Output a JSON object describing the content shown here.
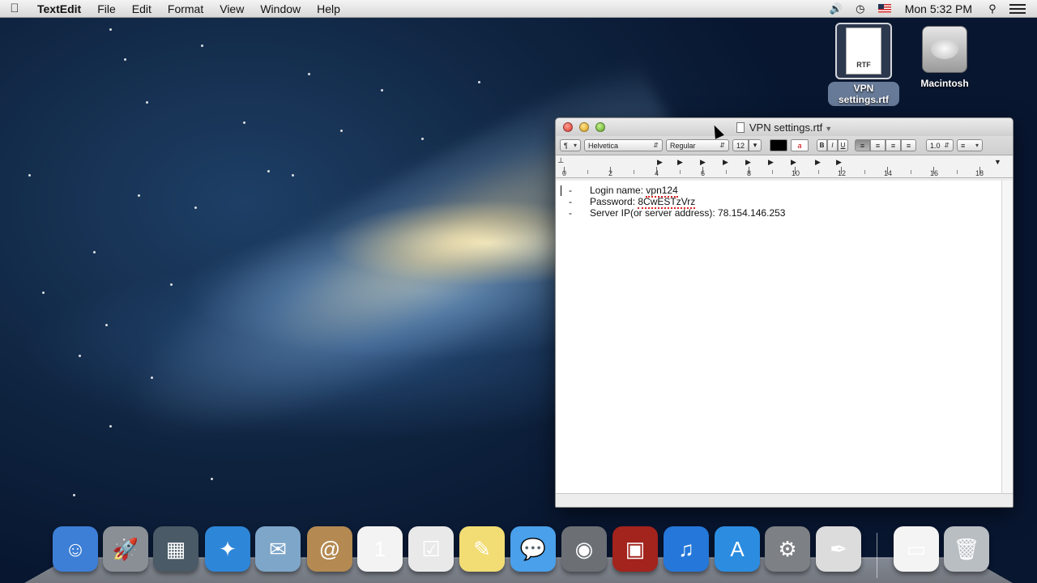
{
  "menubar": {
    "app_name": "TextEdit",
    "menus": [
      "File",
      "Edit",
      "Format",
      "View",
      "Window",
      "Help"
    ],
    "clock": "Mon 5:32 PM"
  },
  "desktop": {
    "rtf_file": {
      "label_line1": "VPN",
      "label_line2": "settings.rtf",
      "doc_badge": "RTF"
    },
    "hard_drive": {
      "label": "Macintosh"
    }
  },
  "window": {
    "title": "VPN  settings.rtf",
    "toolbar": {
      "paragraph": "¶",
      "font_family": "Helvetica",
      "typeface": "Regular",
      "font_size": "12",
      "bold": "B",
      "italic": "I",
      "underline": "U",
      "line_spacing": "1.0",
      "highlight_glyph": "a"
    },
    "ruler_numbers": [
      "0",
      "2",
      "4",
      "6",
      "8",
      "10",
      "12",
      "14",
      "16",
      "18"
    ],
    "document_lines": [
      {
        "bullet": "-",
        "label": "Login name: ",
        "value": "vpn124"
      },
      {
        "bullet": "-",
        "label": "Password: ",
        "value": "8CwESTzVrz"
      },
      {
        "bullet": "-",
        "label": "Server IP(or server address): ",
        "value": "78.154.146.253"
      }
    ]
  },
  "dock": {
    "apps": [
      {
        "name": "finder",
        "glyph": "☺",
        "color": "#3d7fd6"
      },
      {
        "name": "launchpad",
        "glyph": "🚀",
        "color": "#8a8f96"
      },
      {
        "name": "photo-booth-mission-control",
        "glyph": "▦",
        "color": "#4a5a66"
      },
      {
        "name": "safari",
        "glyph": "✦",
        "color": "#2e86d8"
      },
      {
        "name": "mail",
        "glyph": "✉",
        "color": "#7ea6c9"
      },
      {
        "name": "contacts",
        "glyph": "@",
        "color": "#b48a52"
      },
      {
        "name": "calendar",
        "glyph": "1",
        "color": "#f3f3f3"
      },
      {
        "name": "reminders",
        "glyph": "☑",
        "color": "#e9e9e9"
      },
      {
        "name": "notes",
        "glyph": "✎",
        "color": "#f2dd74"
      },
      {
        "name": "messages",
        "glyph": "💬",
        "color": "#4aa0ea"
      },
      {
        "name": "facetime",
        "glyph": "◉",
        "color": "#6c7075"
      },
      {
        "name": "photo-booth",
        "glyph": "▣",
        "color": "#a3231d"
      },
      {
        "name": "itunes",
        "glyph": "♫",
        "color": "#2577d9"
      },
      {
        "name": "app-store",
        "glyph": "A",
        "color": "#2c8ce0"
      },
      {
        "name": "system-preferences",
        "glyph": "⚙",
        "color": "#7d8084"
      },
      {
        "name": "textedit",
        "glyph": "✒",
        "color": "#dcdcdc"
      },
      {
        "name": "document-stack",
        "glyph": "▭",
        "color": "#f4f4f4"
      },
      {
        "name": "trash",
        "glyph": "🗑",
        "color": "#b9bec3"
      }
    ]
  }
}
